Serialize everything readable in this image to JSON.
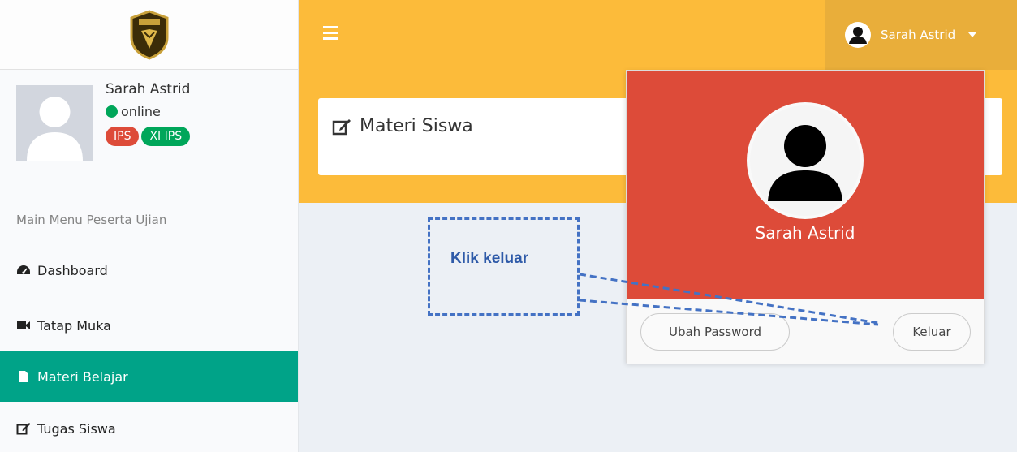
{
  "sidebar": {
    "user": {
      "name": "Sarah Astrid",
      "status": "online",
      "badges": [
        {
          "label": "IPS",
          "color": "#dd4b39"
        },
        {
          "label": "XI IPS",
          "color": "#00a65a"
        }
      ]
    },
    "menu_header": "Main Menu Peserta Ujian",
    "items": [
      {
        "label": "Dashboard",
        "icon": "dashboard-icon"
      },
      {
        "label": "Tatap Muka",
        "icon": "video-camera-icon"
      },
      {
        "label": "Materi Belajar",
        "icon": "file-icon",
        "active": true
      },
      {
        "label": "Tugas Siswa",
        "icon": "edit-icon"
      }
    ]
  },
  "topbar": {
    "user_name": "Sarah Astrid",
    "accent": "#fcbb3a"
  },
  "content": {
    "card_title": "Materi Siswa"
  },
  "dropdown": {
    "name": "Sarah Astrid",
    "header_color": "#dd4b39",
    "change_password_label": "Ubah Password",
    "logout_label": "Keluar"
  },
  "annotation": {
    "text": "Klik keluar",
    "color": "#4472c4"
  }
}
